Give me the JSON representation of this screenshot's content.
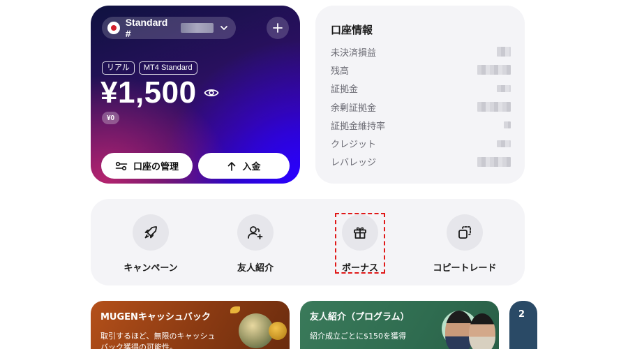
{
  "account_card": {
    "account_name": "Standard #",
    "tags": [
      "リアル",
      "MT4 Standard"
    ],
    "balance": "¥1,500",
    "sub_balance": "¥0",
    "manage_button": "口座の管理",
    "deposit_button": "入金"
  },
  "account_info": {
    "title": "口座情報",
    "rows": [
      {
        "label": "未決済損益"
      },
      {
        "label": "残高"
      },
      {
        "label": "証拠金"
      },
      {
        "label": "余剰証拠金"
      },
      {
        "label": "証拠金維持率"
      },
      {
        "label": "クレジット"
      },
      {
        "label": "レバレッジ"
      }
    ]
  },
  "quick_actions": [
    {
      "label": "キャンペーン",
      "icon": "rocket-icon"
    },
    {
      "label": "友人紹介",
      "icon": "user-plus-icon"
    },
    {
      "label": "ボーナス",
      "icon": "gift-icon",
      "highlighted": true
    },
    {
      "label": "コピートレード",
      "icon": "copy-icon"
    }
  ],
  "promos": [
    {
      "title": "MUGENキャッシュバック",
      "text": "取引するほど、無限のキャッシュバック獲得の可能性。"
    },
    {
      "title": "友人紹介（プログラム）",
      "text": "紹介成立ごとに$150を獲得"
    },
    {
      "title": "2"
    }
  ],
  "colors": {
    "card_text": "#ffffff",
    "panel_bg": "#f4f4f7",
    "highlight_border": "#e01818",
    "cashback_bg": "#b4501a",
    "referral_bg": "#3a7a5a"
  }
}
